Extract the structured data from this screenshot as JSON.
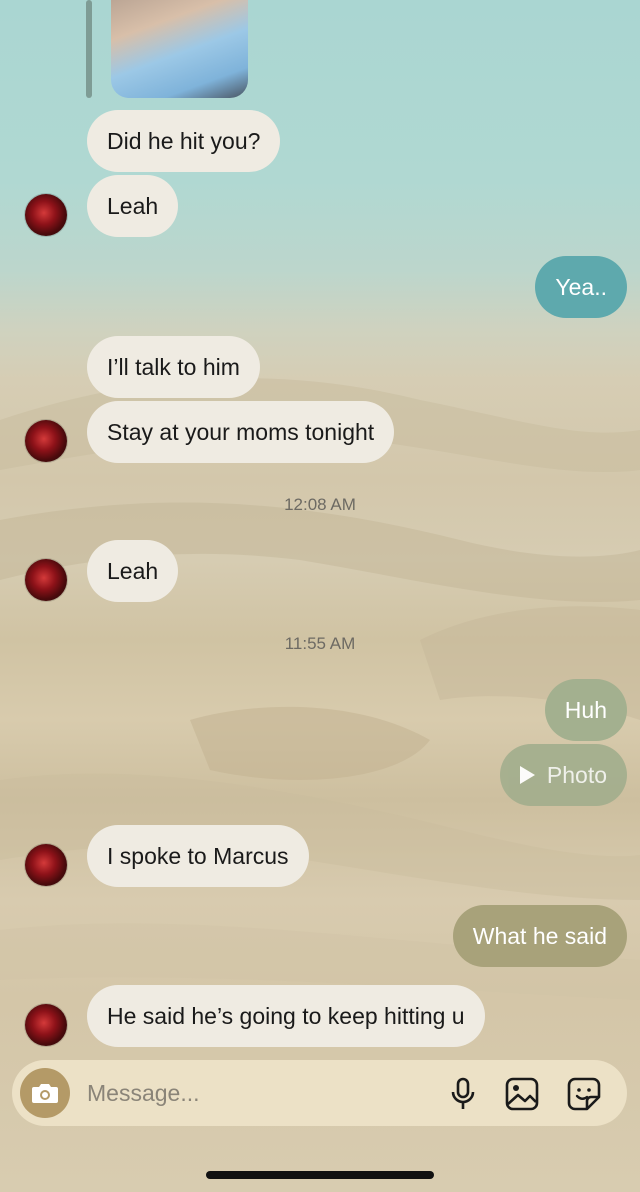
{
  "thread": {
    "messages": [
      {
        "text": "Did he hit you?"
      },
      {
        "text": "Leah"
      },
      {
        "text": "Yea.."
      },
      {
        "text": "I’ll talk to him"
      },
      {
        "text": "Stay at your moms tonight"
      },
      {
        "text": "Leah"
      },
      {
        "text": "Huh"
      },
      {
        "text": "Photo"
      },
      {
        "text": "I spoke to Marcus"
      },
      {
        "text": "What he said"
      },
      {
        "text": "He said he’s going to keep hitting u"
      }
    ],
    "timestamps": [
      "12:08 AM",
      "11:55 AM"
    ]
  },
  "composer": {
    "placeholder": "Message..."
  },
  "colors": {
    "incoming_bubble": "#efebe2",
    "outgoing_teal": "#5ea9ad",
    "outgoing_sage": "#a3b08f",
    "outgoing_khaki": "#a8a27a"
  },
  "icons": [
    "camera-icon",
    "microphone-icon",
    "image-icon",
    "sticker-icon",
    "play-icon"
  ]
}
